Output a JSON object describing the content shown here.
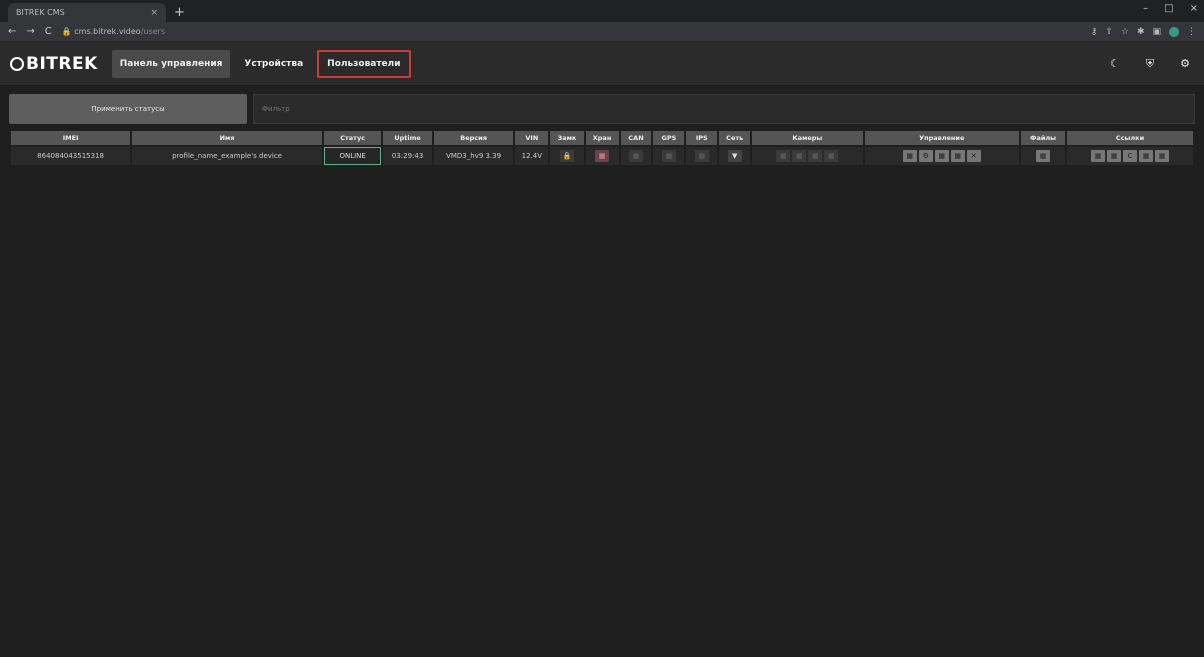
{
  "browser": {
    "tab_title": "BITREK CMS",
    "tab_close": "×",
    "new_tab": "+",
    "url": "cms.bitrek.video",
    "url_path": "/users",
    "nav": {
      "back": "←",
      "forward": "→",
      "reload": "C"
    },
    "window": {
      "minimize": "–",
      "maximize": "□",
      "close": "×"
    }
  },
  "header": {
    "logo_text": "BITREK",
    "nav": [
      {
        "label": "Панель управления"
      },
      {
        "label": "Устройства"
      },
      {
        "label": "Пользователи"
      }
    ],
    "icons": [
      "moon-icon",
      "shield-icon",
      "gear-icon"
    ]
  },
  "toolbar": {
    "refresh_label": "Применить статусы",
    "filter_placeholder": "Фильтр"
  },
  "table": {
    "headers": [
      "IMEI",
      "Имя",
      "Статус",
      "Uptime",
      "Версия",
      "VIN",
      "Замк",
      "Хран",
      "CAN",
      "GPS",
      "IPS",
      "Сеть",
      "Камеры",
      "Управление",
      "Файлы",
      "Ссылки"
    ],
    "rows": [
      {
        "imei": "864084043515318",
        "name": "profile_name_example's device",
        "status": "ONLINE",
        "uptime": "03:29:43",
        "version": "VMD3_hv9 3.39",
        "vin": "12.4V",
        "lock": "🔒",
        "storage": "▦",
        "can": "▦",
        "gps": "▦",
        "ips": "▦",
        "net": "▼",
        "cameras": [
          "▦",
          "▦",
          "▦",
          "▦"
        ],
        "controls": [
          "▦",
          "⚙",
          "▦",
          "▦",
          "✕"
        ],
        "files": "▦",
        "links": [
          "▦",
          "▦",
          "C",
          "▦",
          "▦"
        ]
      }
    ]
  }
}
